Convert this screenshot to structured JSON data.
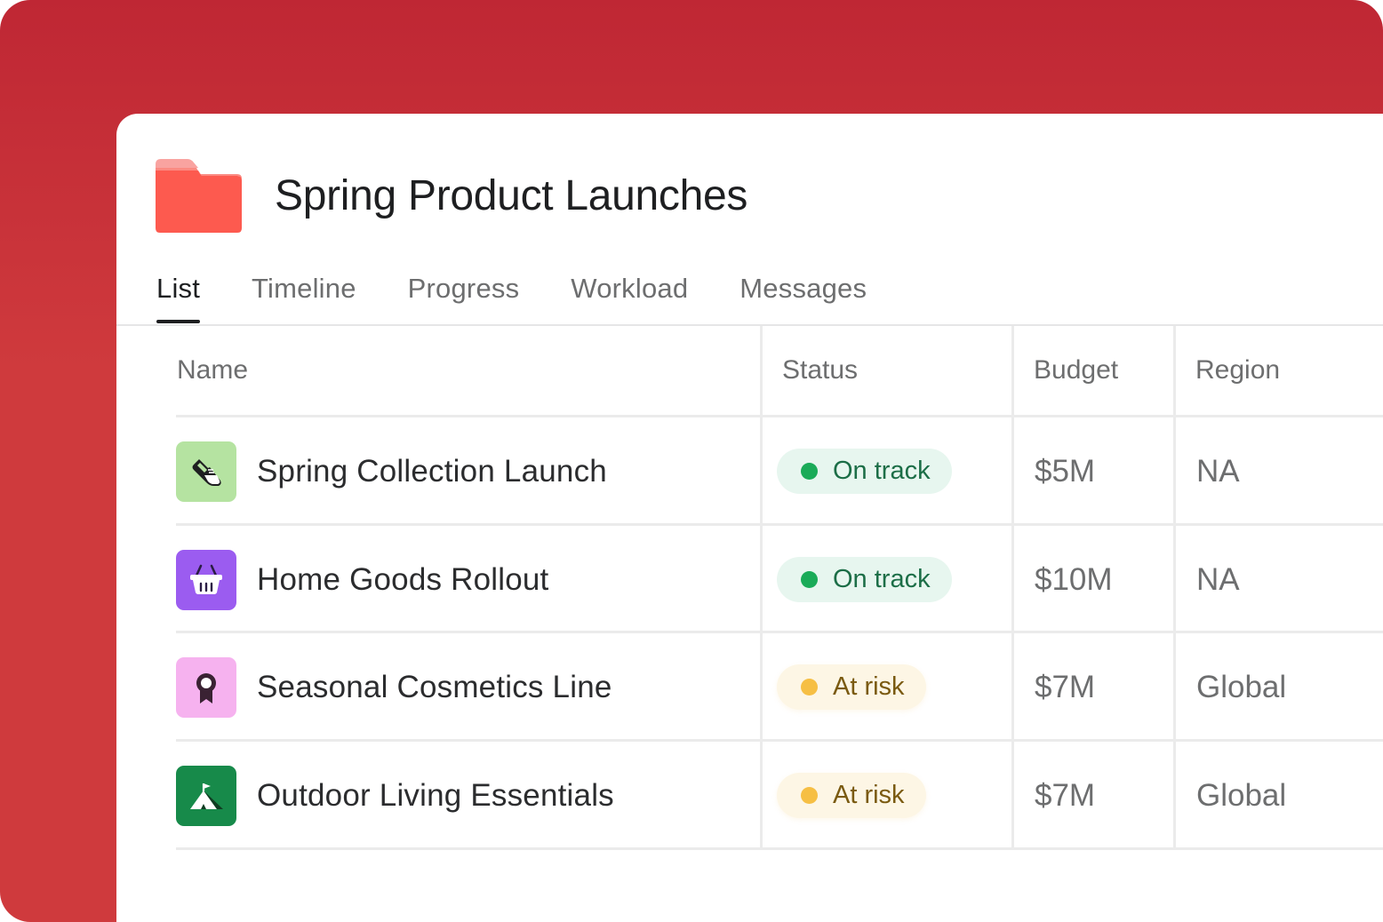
{
  "project": {
    "title": "Spring Product Launches",
    "icon": "folder-icon",
    "folder_color": "#fd5a4f"
  },
  "tabs": [
    {
      "label": "List",
      "active": true
    },
    {
      "label": "Timeline",
      "active": false
    },
    {
      "label": "Progress",
      "active": false
    },
    {
      "label": "Workload",
      "active": false
    },
    {
      "label": "Messages",
      "active": false
    }
  ],
  "table": {
    "columns": [
      "Name",
      "Status",
      "Budget",
      "Region"
    ],
    "rows": [
      {
        "name": "Spring Collection Launch",
        "icon": "sneaker-icon",
        "icon_bg": "#b5e3a1",
        "status": "On track",
        "status_kind": "ok",
        "budget": "$5M",
        "region": "NA"
      },
      {
        "name": "Home Goods Rollout",
        "icon": "basket-icon",
        "icon_bg": "#9b5cf0",
        "status": "On track",
        "status_kind": "ok",
        "budget": "$10M",
        "region": "NA"
      },
      {
        "name": "Seasonal Cosmetics Line",
        "icon": "award-ribbon-icon",
        "icon_bg": "#f6b2ef",
        "status": "At risk",
        "status_kind": "risk",
        "budget": "$7M",
        "region": "Global"
      },
      {
        "name": "Outdoor Living Essentials",
        "icon": "tent-icon",
        "icon_bg": "#178a4a",
        "status": "At risk",
        "status_kind": "risk",
        "budget": "$7M",
        "region": "Global"
      }
    ]
  },
  "colors": {
    "background": "#c52f38",
    "on_track_dot": "#1aab58",
    "at_risk_dot": "#f6bf44"
  }
}
